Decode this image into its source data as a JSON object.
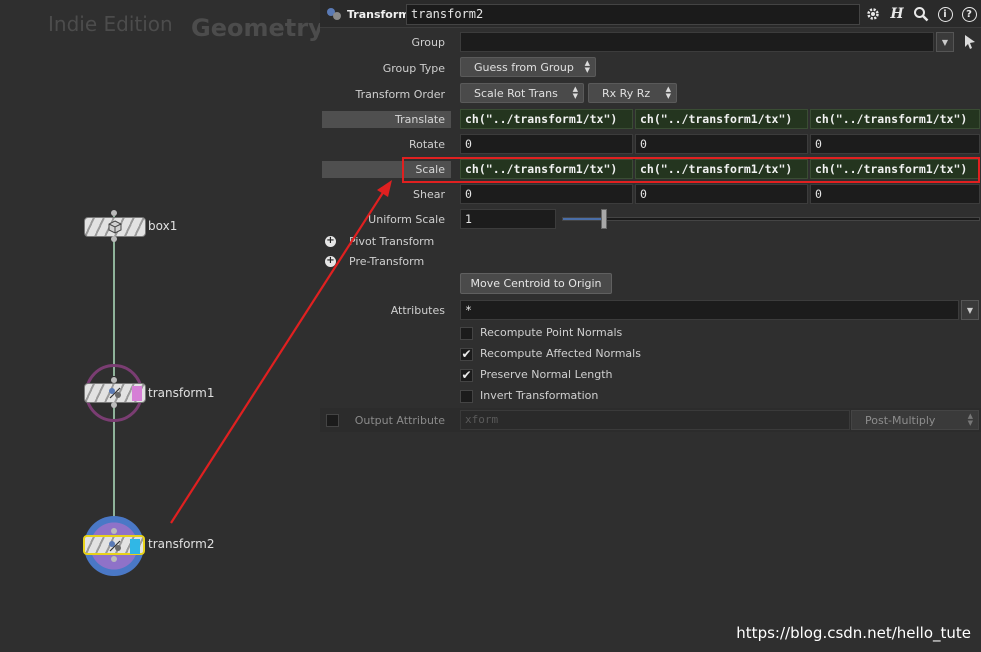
{
  "network": {
    "edition_watermark": "Indie Edition",
    "context_watermark": "Geometry",
    "nodes": [
      {
        "name": "box1"
      },
      {
        "name": "transform1"
      },
      {
        "name": "transform2"
      }
    ]
  },
  "toolbar": {
    "op_type": "Transform",
    "node_name": "transform2",
    "icons": [
      "gear-icon",
      "help-h-icon",
      "search-icon",
      "info-icon",
      "question-icon"
    ]
  },
  "params": {
    "group": {
      "label": "Group",
      "value": ""
    },
    "group_type": {
      "label": "Group Type",
      "value": "Guess from Group"
    },
    "transform_order": {
      "label": "Transform Order",
      "value": "Scale Rot Trans",
      "rot_order": "Rx Ry Rz"
    },
    "translate": {
      "label": "Translate",
      "values": [
        "ch(\"../transform1/tx\")",
        "ch(\"../transform1/tx\")",
        "ch(\"../transform1/tx\")"
      ]
    },
    "rotate": {
      "label": "Rotate",
      "values": [
        "0",
        "0",
        "0"
      ]
    },
    "scale": {
      "label": "Scale",
      "values": [
        "ch(\"../transform1/tx\")",
        "ch(\"../transform1/tx\")",
        "ch(\"../transform1/tx\")"
      ]
    },
    "shear": {
      "label": "Shear",
      "values": [
        "0",
        "0",
        "0"
      ]
    },
    "uniform_scale": {
      "label": "Uniform Scale",
      "value": "1",
      "slider_fraction": 0.1
    },
    "pivot_transform": {
      "label": "Pivot Transform"
    },
    "pre_transform": {
      "label": "Pre-Transform"
    },
    "move_centroid": {
      "label": "Move Centroid to Origin"
    },
    "attributes": {
      "label": "Attributes",
      "value": "*"
    },
    "checkboxes": [
      {
        "label": "Recompute Point Normals",
        "checked": false
      },
      {
        "label": "Recompute Affected Normals",
        "checked": true
      },
      {
        "label": "Preserve Normal Length",
        "checked": true
      },
      {
        "label": "Invert Transformation",
        "checked": false
      }
    ],
    "output_attribute": {
      "label": "Output Attribute",
      "placeholder": "xform",
      "mode": "Post-Multiply"
    }
  },
  "blog_watermark": "https://blog.csdn.net/hello_tute",
  "colors": {
    "expression_bg": "#24351f",
    "highlight_box": "#e02020",
    "wire": "#8fb39a",
    "selected_node_outline": "#e8d21a"
  }
}
